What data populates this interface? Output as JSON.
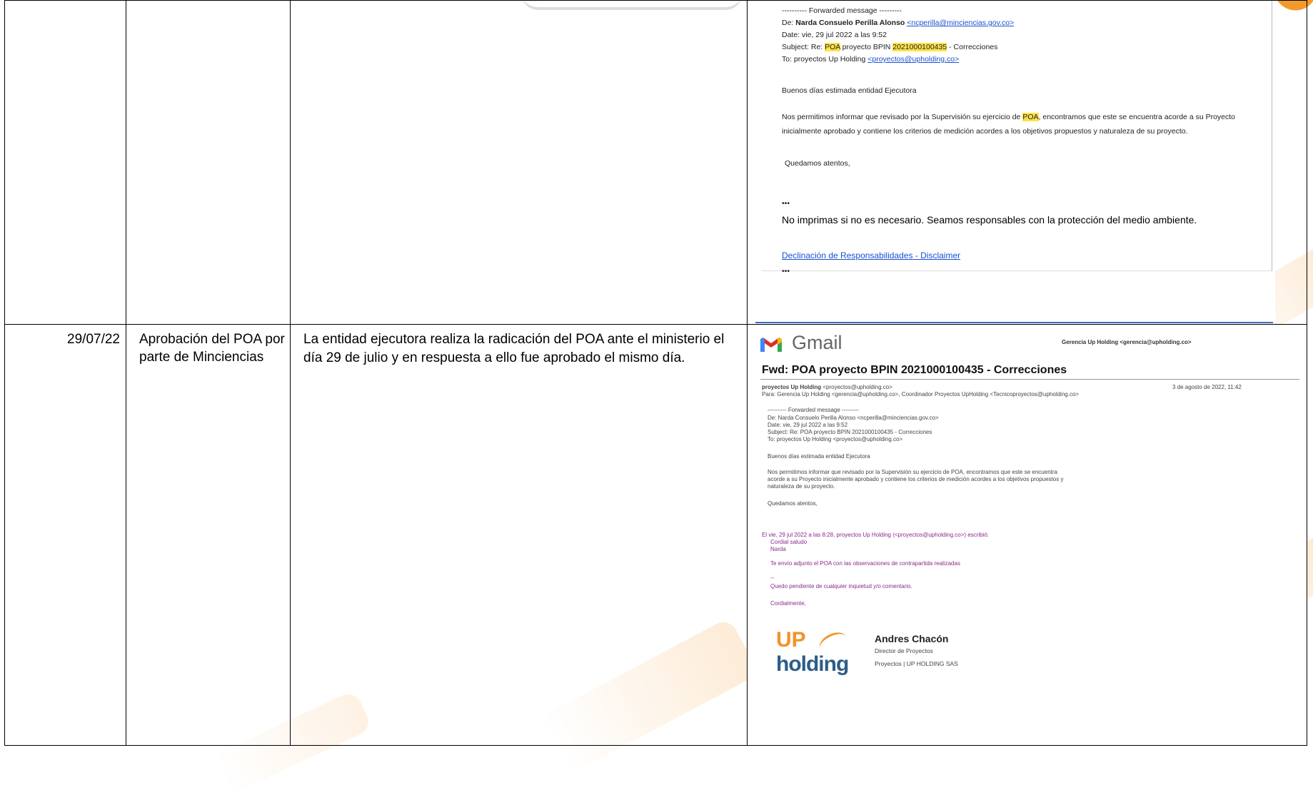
{
  "rows": [
    {
      "date": "",
      "activity": "",
      "description": "",
      "evidence": {
        "forwarded_header": "---------- Forwarded message ---------",
        "from_label": "De:",
        "from_name": "Narda Consuelo Perilla Alonso",
        "from_email": "<ncperilla@minciencias.gov.co>",
        "date_line": "Date: vie, 29 jul 2022 a las 9:52",
        "subject_label": "Subject: Re:",
        "subject_poa": "POA",
        "subject_mid": "proyecto BPIN",
        "subject_bpin": "2021000100435",
        "subject_end": "- Correcciones",
        "to_label": "To: proyectos Up Holding",
        "to_email": "<proyectos@upholding.co>",
        "greeting": "Buenos días estimada entidad Ejecutora",
        "body_start": "Nos permitimos informar que revisado por la Supervisión su ejercicio de",
        "body_poa": "POA",
        "body_end": ", encontramos que este se encuentra acorde a su Proyecto inicialmente aprobado y contiene los criterios de medición acordes a los objetivos propuestos y naturaleza de su proyecto.",
        "closing": "Quedamos atentos,",
        "ellipsis": "•••",
        "print_notice": "No imprimas si no es necesario. Seamos responsables con la protección del medio ambiente.",
        "disclaimer_link": "Declinación de Responsabilidades - Disclaimer",
        "ellipsis2": "•••"
      }
    },
    {
      "date": "29/07/22",
      "activity": "Aprobación del POA por parte de Minciencias",
      "description": "La entidad ejecutora realiza la radicación del POA ante el ministerio el día 29 de julio y en respuesta a ello fue aprobado el mismo día.",
      "evidence": {
        "app_name": "Gmail",
        "account": "Gerencia Up Holding <gerencia@upholding.co>",
        "subject": "Fwd: POA proyecto BPIN 2021000100435 - Correcciones",
        "sender_name": "proyectos Up Holding",
        "sender_email": "<proyectos@upholding.co>",
        "sent_date": "3 de agosto de 2022, 11:42",
        "to_line": "Para: Gerencia Up Holding <gerencia@upholding.co>, Coordinador Proyectos UpHolding <Tecnicoproyectos@upholding.co>",
        "fwd_header": "---------- Forwarded message ---------",
        "fwd_from": "De: Narda Consuelo Perilla Alonso <ncperilla@minciencias.gov.co>",
        "fwd_date": "Date: vie, 29 jul 2022 a las 9:52",
        "fwd_subject": "Subject: Re: POA proyecto BPIN 2021000100435 - Correcciones",
        "fwd_to": "To: proyectos Up Holding <proyectos@upholding.co>",
        "greeting": "Buenos días estimada entidad Ejecutora",
        "body_line1": "Nos permitimos informar que revisado por la Supervisión su ejercicio de POA, encontramos que este se encuentra",
        "body_line2": "acorde a su Proyecto inicialmente aprobado y contiene los criterios de medición acordes a los objetivos propuestos y",
        "body_line3": "naturaleza de su proyecto.",
        "closing": "Quedamos atentos,",
        "quoted_header": "El vie, 29 jul 2022 a las 8:28, proyectos Up Holding (<proyectos@upholding.co>) escribió:",
        "quoted_salute": "Cordial saludo",
        "quoted_name": "Narda",
        "quoted_body": "Te envío adjunto el POA con las observaciones de contrapartida realizadas",
        "quoted_dash": "--",
        "quoted_pending": "Quedo pendiente de cualquier inquietud y/o comentario.",
        "quoted_regards": "Cordialmente,",
        "logo_up": "UP",
        "logo_holding": "holding",
        "sig_name": "Andres Chacón",
        "sig_role": "Director de Proyectos",
        "sig_company": "Proyectos | UP HOLDING SAS"
      }
    }
  ]
}
